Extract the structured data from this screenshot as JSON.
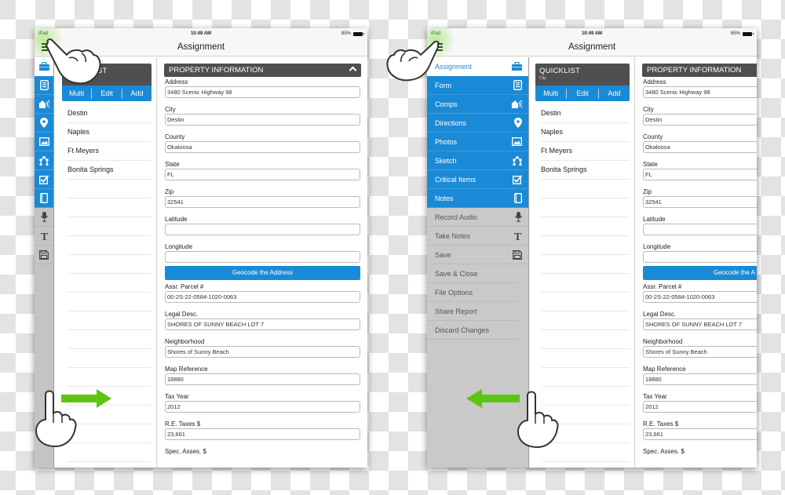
{
  "status_bar": {
    "carrier": "iPad",
    "time": "10:49 AM",
    "battery": "85%"
  },
  "nav": {
    "title": "Assignment",
    "menu_icon": "hamburger-icon"
  },
  "rail_icons": [
    {
      "name": "briefcase-icon",
      "state": "active"
    },
    {
      "name": "form-icon",
      "state": "blue"
    },
    {
      "name": "comps-icon",
      "state": "blue"
    },
    {
      "name": "location-pin-icon",
      "state": "blue"
    },
    {
      "name": "photo-icon",
      "state": "blue"
    },
    {
      "name": "sketch-icon",
      "state": "blue"
    },
    {
      "name": "checkbox-icon",
      "state": "blue"
    },
    {
      "name": "notes-icon",
      "state": "blue"
    },
    {
      "name": "microphone-icon",
      "state": "gray"
    },
    {
      "name": "text-icon",
      "state": "gray"
    },
    {
      "name": "save-icon",
      "state": "gray"
    }
  ],
  "side_menu": {
    "items": [
      {
        "label": "Assignment",
        "icon": "briefcase-icon",
        "state": "active"
      },
      {
        "label": "Form",
        "icon": "form-icon",
        "state": "blue"
      },
      {
        "label": "Comps",
        "icon": "comps-icon",
        "state": "blue"
      },
      {
        "label": "Directions",
        "icon": "location-pin-icon",
        "state": "blue"
      },
      {
        "label": "Photos",
        "icon": "photo-icon",
        "state": "blue"
      },
      {
        "label": "Sketch",
        "icon": "sketch-icon",
        "state": "blue"
      },
      {
        "label": "Critical Items",
        "icon": "checkbox-icon",
        "state": "blue"
      },
      {
        "label": "Notes",
        "icon": "notes-icon",
        "state": "blue"
      },
      {
        "label": "Record Audio",
        "icon": "microphone-icon",
        "state": "gray"
      },
      {
        "label": "Take Notes",
        "icon": "text-icon",
        "state": "gray"
      },
      {
        "label": "Save",
        "icon": "save-icon",
        "state": "gray"
      },
      {
        "label": "Save & Close",
        "icon": "",
        "state": "gray"
      },
      {
        "label": "File Options",
        "icon": "",
        "state": "gray"
      },
      {
        "label": "Share Report",
        "icon": "",
        "state": "gray"
      },
      {
        "label": "Discard Changes",
        "icon": "",
        "state": "gray"
      }
    ]
  },
  "quicklist": {
    "title": "QUICKLIST",
    "title_partial": "ST",
    "subtitle": "City",
    "actions": [
      "Multi",
      "Edit",
      "Add"
    ],
    "items": [
      "Destin",
      "Naples",
      "Ft Meyers",
      "Bonita Springs"
    ]
  },
  "property": {
    "header": "PROPERTY INFORMATION",
    "geocode_label": "Geocode the Address",
    "geocode_label_partial": "Geocode the A",
    "fields_top": [
      {
        "label": "Address",
        "value": "3480 Scenic Highway 98"
      },
      {
        "label": "City",
        "value": "Destin"
      },
      {
        "label": "County",
        "value": "Okaloosa"
      },
      {
        "label": "State",
        "value": "FL"
      },
      {
        "label": "Zip",
        "value": "32541"
      },
      {
        "label": "Latitude",
        "value": ""
      },
      {
        "label": "Longitude",
        "value": ""
      }
    ],
    "fields_bottom": [
      {
        "label": "Assr. Parcel #",
        "value": "00-2S-22-0584-1020-0063"
      },
      {
        "label": "Legal Desc.",
        "value": "SHORES OF SUNNY BEACH LOT 7"
      },
      {
        "label": "Neighborhood",
        "value": "Shores of Sunny Beach"
      },
      {
        "label": "Map Reference",
        "value": "18880"
      },
      {
        "label": "Tax Year",
        "value": "2012"
      },
      {
        "label": "R.E. Taxes $",
        "value": "23,661"
      },
      {
        "label": "Spec. Asses. $",
        "value": ""
      }
    ]
  },
  "colors": {
    "accent_blue": "#1b8ad6",
    "header_dark": "#4f4f4f",
    "gesture_arrow": "#5cc514",
    "menu_gray": "#c9c9c9"
  },
  "annotations": {
    "left_gesture": "swipe-right",
    "right_gesture": "swipe-left"
  }
}
